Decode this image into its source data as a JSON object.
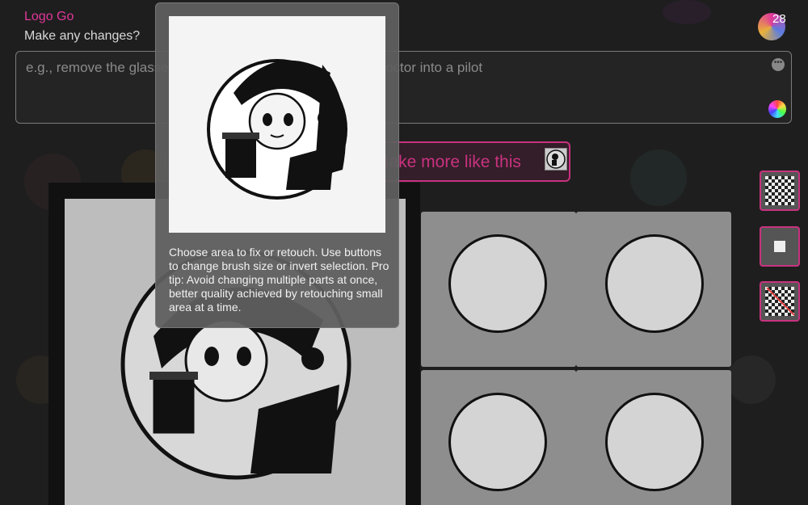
{
  "app": {
    "title": "Logo Go",
    "notification_count": "28"
  },
  "prompt": {
    "label": "Make any changes?",
    "placeholder": "e.g., remove the glasses, make the shirt pink, change the doctor into a pilot"
  },
  "generate": {
    "label": "Make more like this"
  },
  "tools": [
    {
      "name": "large-brush",
      "icon": "checker-grid-icon"
    },
    {
      "name": "small-brush",
      "icon": "small-square-icon"
    },
    {
      "name": "invert-selection",
      "icon": "invert-icon"
    }
  ],
  "tooltip": {
    "text": "Choose area to fix or retouch. Use buttons to change brush size or invert selection. Pro tip: Avoid changing multiple parts at once, better quality achieved by retouching small area at a time."
  },
  "colors": {
    "accent": "#c8327f",
    "title": "#e0389a"
  }
}
